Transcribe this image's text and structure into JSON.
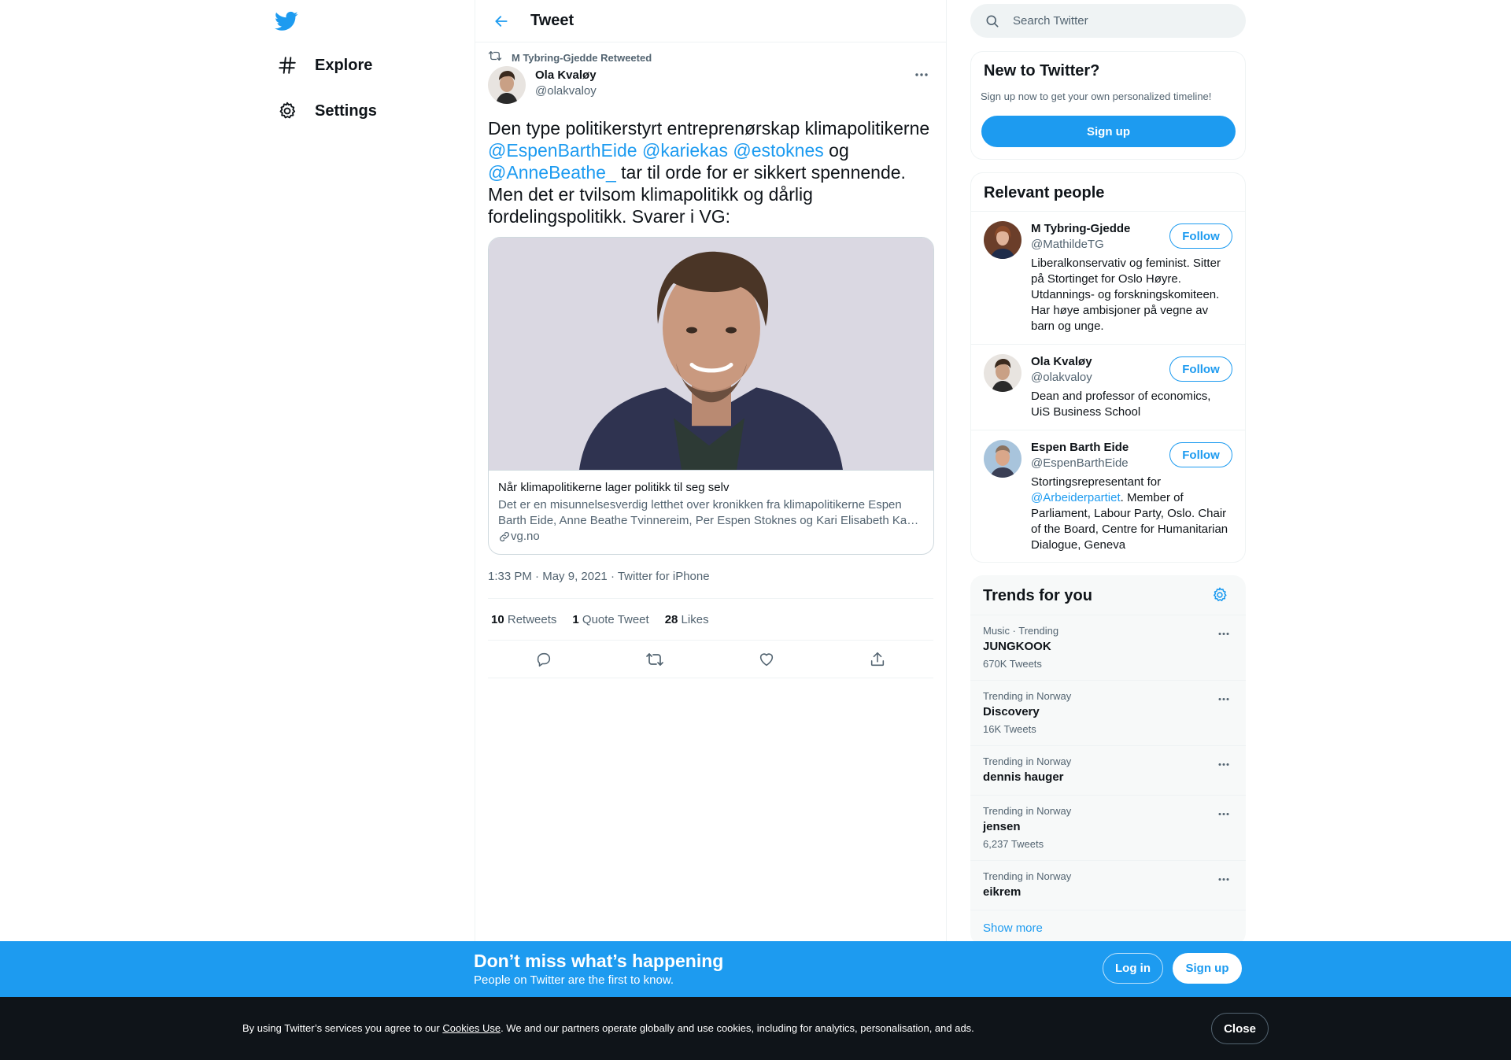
{
  "colors": {
    "accent": "#1d9bf0",
    "text": "#0f1419",
    "secondary": "#536471",
    "border": "#eff3f4",
    "cookie_bg": "#0f1419"
  },
  "nav": {
    "logo": "twitter-bird-icon",
    "items": [
      {
        "label": "Explore",
        "icon": "hashtag-icon"
      },
      {
        "label": "Settings",
        "icon": "gear-icon"
      }
    ]
  },
  "header": {
    "title": "Tweet",
    "back_icon": "back-arrow-icon"
  },
  "tweet": {
    "retweeted_by": "M Tybring-Gjedde Retweeted",
    "author_name": "Ola Kvaløy",
    "author_handle": "@olakvaloy",
    "text_parts": [
      "Den type politikerstyrt entreprenørskap klimapolitikerne ",
      "@EspenBarthEide",
      " ",
      "@kariekas",
      " ",
      "@estoknes",
      " og ",
      "@AnneBeathe_",
      "  tar til orde for er sikkert spennende. Men det er tvilsom klimapolitikk og dårlig fordelingspolitikk. Svarer i VG:"
    ],
    "card": {
      "title": "Når klimapolitikerne lager politikk til seg selv",
      "description": "Det er en misunnelsesverdig letthet over kronikken fra klimapolitikerne Espen Barth Eide, Anne Beathe Tvinnereim, Per Espen Stoknes og Kari Elisabeth Ka…",
      "domain": "vg.no"
    },
    "time": "1:33 PM",
    "separator": " · ",
    "date": "May 9, 2021",
    "source": "Twitter for iPhone",
    "stats": [
      {
        "count": "10",
        "label": "Retweets"
      },
      {
        "count": "1",
        "label": "Quote Tweet"
      },
      {
        "count": "28",
        "label": "Likes"
      }
    ]
  },
  "search": {
    "placeholder": "Search Twitter"
  },
  "new_to_twitter": {
    "title": "New to Twitter?",
    "subtitle": "Sign up now to get your own personalized timeline!",
    "signup_label": "Sign up"
  },
  "relevant_people": {
    "title": "Relevant people",
    "follow_label": "Follow",
    "people": [
      {
        "name": "M Tybring-Gjedde",
        "handle": "@MathildeTG",
        "bio": "Liberalkonservativ og feminist. Sitter på Stortinget for Oslo Høyre. Utdannings- og forskningskomiteen. Har høye ambisjoner på vegne av barn og unge."
      },
      {
        "name": "Ola Kvaløy",
        "handle": "@olakvaloy",
        "bio": "Dean and professor of economics, UiS Business School"
      },
      {
        "name": "Espen Barth Eide",
        "handle": "@EspenBarthEide",
        "bio_prefix": "Stortingsrepresentant for ",
        "bio_link": "@Arbeiderpartiet",
        "bio_suffix": ". Member of Parliament, Labour Party, Oslo. Chair of the Board, Centre for Humanitarian Dialogue, Geneva"
      }
    ]
  },
  "trends": {
    "title": "Trends for you",
    "items": [
      {
        "meta": "Music · Trending",
        "name": "JUNGKOOK",
        "count": "670K Tweets"
      },
      {
        "meta": "Trending in Norway",
        "name": "Discovery",
        "count": "16K Tweets"
      },
      {
        "meta": "Trending in Norway",
        "name": "dennis hauger",
        "count": ""
      },
      {
        "meta": "Trending in Norway",
        "name": "jensen",
        "count": "6,237 Tweets"
      },
      {
        "meta": "Trending in Norway",
        "name": "eikrem",
        "count": ""
      }
    ],
    "show_more": "Show more"
  },
  "bottom_bar": {
    "title": "Don’t miss what’s happening",
    "subtitle": "People on Twitter are the first to know.",
    "login_label": "Log in",
    "signup_label": "Sign up"
  },
  "cookie": {
    "text_before": "By using Twitter’s services you agree to our ",
    "link": "Cookies Use",
    "text_after": ". We and our partners operate globally and use cookies, including for analytics, personalisation, and ads.",
    "close_label": "Close"
  }
}
